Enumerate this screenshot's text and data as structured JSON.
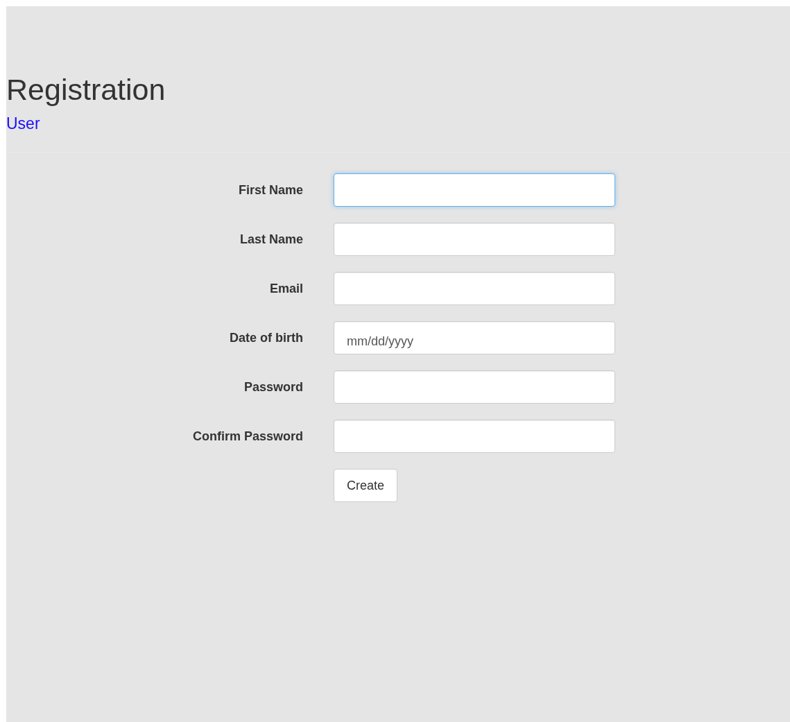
{
  "header": {
    "title": "Registration",
    "link": "User"
  },
  "form": {
    "fields": [
      {
        "label": "First Name",
        "focused": true
      },
      {
        "label": "Last Name",
        "focused": false
      },
      {
        "label": "Email",
        "focused": false
      },
      {
        "label": "Date of birth",
        "focused": false,
        "placeholder": "mm/dd/yyyy"
      },
      {
        "label": "Password",
        "focused": false
      },
      {
        "label": "Confirm Password",
        "focused": false
      }
    ],
    "submit": "Create"
  }
}
